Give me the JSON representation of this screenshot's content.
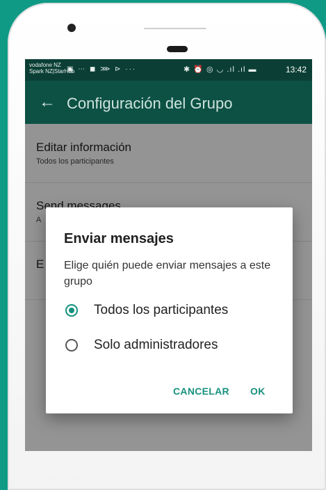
{
  "status_bar": {
    "carrier_line1": "vodafone NZ",
    "carrier_line2": "Spark NZ|StarHub",
    "notification_icons": "▣ ⋯ ◼ ⋙ ⊳ ···",
    "system_icons": "✱ ⏰ ◎ ◡ .ıl .ıl ▬",
    "time": "13:42"
  },
  "app_bar": {
    "back_icon": "←",
    "title": "Configuración del Grupo"
  },
  "settings": [
    {
      "title": "Editar información",
      "subtitle": "Todos los participantes"
    },
    {
      "title": "Send messages",
      "subtitle": "A"
    },
    {
      "title": "E",
      "subtitle": ""
    }
  ],
  "dialog": {
    "title": "Enviar mensajes",
    "message": "Elige quién puede enviar mensajes a este grupo",
    "options": [
      {
        "label": "Todos los participantes",
        "selected": true
      },
      {
        "label": "Solo administradores",
        "selected": false
      }
    ],
    "cancel_label": "CANCELAR",
    "ok_label": "OK"
  },
  "colors": {
    "accent": "#11917e",
    "app_bar": "#0d5145",
    "status_bar": "#0b3f35",
    "background": "#0f9a86"
  }
}
